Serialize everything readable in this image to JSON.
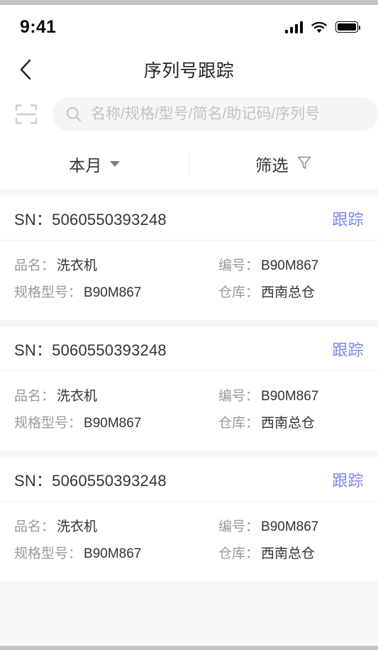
{
  "status_bar": {
    "time": "9:41",
    "signal_icon": "cellular-signal-icon",
    "wifi_icon": "wifi-icon",
    "battery_icon": "battery-full-icon"
  },
  "navbar": {
    "back_icon": "chevron-left-icon",
    "title": "序列号跟踪"
  },
  "search": {
    "scan_icon": "scan-barcode-icon",
    "search_icon": "search-icon",
    "value": "",
    "placeholder": "名称/规格/型号/简名/助记码/序列号"
  },
  "filters": {
    "period": {
      "label": "本月",
      "icon": "chevron-down-icon"
    },
    "filter": {
      "label": "筛选",
      "icon": "funnel-icon"
    }
  },
  "labels": {
    "sn": "SN：",
    "track": "跟踪",
    "product_name": "品名：",
    "spec_model": "规格型号：",
    "code": "编号：",
    "warehouse": "仓库："
  },
  "colors": {
    "link": "#7b87e8",
    "text_primary": "#333333",
    "text_muted": "#9a9a9a",
    "page_bg": "#f7f7f7",
    "card_bg": "#ffffff",
    "search_bg": "#f5f5f5"
  },
  "records": [
    {
      "sn": "5060550393248",
      "track": "跟踪",
      "product_name": "洗衣机",
      "spec_model": "B90M867",
      "code": "B90M867",
      "warehouse": "西南总仓"
    },
    {
      "sn": "5060550393248",
      "track": "跟踪",
      "product_name": "洗衣机",
      "spec_model": "B90M867",
      "code": "B90M867",
      "warehouse": "西南总仓"
    },
    {
      "sn": "5060550393248",
      "track": "跟踪",
      "product_name": "洗衣机",
      "spec_model": "B90M867",
      "code": "B90M867",
      "warehouse": "西南总仓"
    }
  ]
}
